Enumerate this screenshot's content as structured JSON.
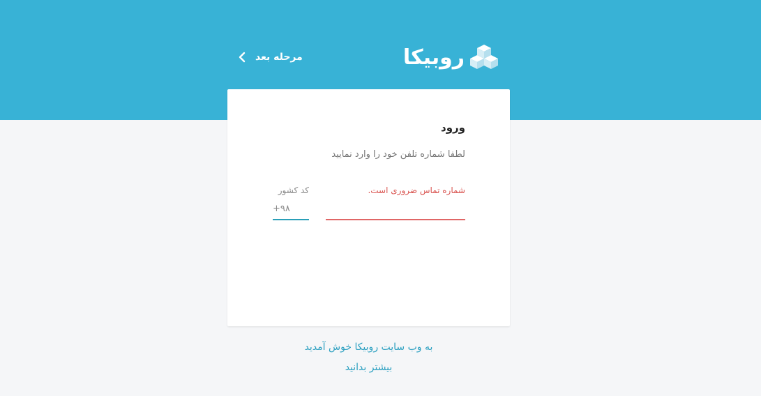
{
  "header": {
    "logo_text": "روبیکا",
    "logo_icon": "cube-icon",
    "next_step_label": "مرحله بعد",
    "next_step_icon": "chevron-left-icon",
    "background_color": "#38b2d6"
  },
  "login_card": {
    "title": "ورود",
    "subtitle": "لطفا شماره تلفن خود را وارد نمایید",
    "phone": {
      "error_text": "شماره تماس ضروری است.",
      "value": "",
      "error_color": "#e06666"
    },
    "country_code": {
      "label": "کد کشور",
      "value": "+۹۸",
      "underline_color": "#2a9fb8"
    }
  },
  "footer": {
    "welcome_text": "به وب سایت روبیکا خوش آمدید",
    "learn_more_link": "بیشتر بدانید",
    "link_color": "#2a9fc0"
  }
}
